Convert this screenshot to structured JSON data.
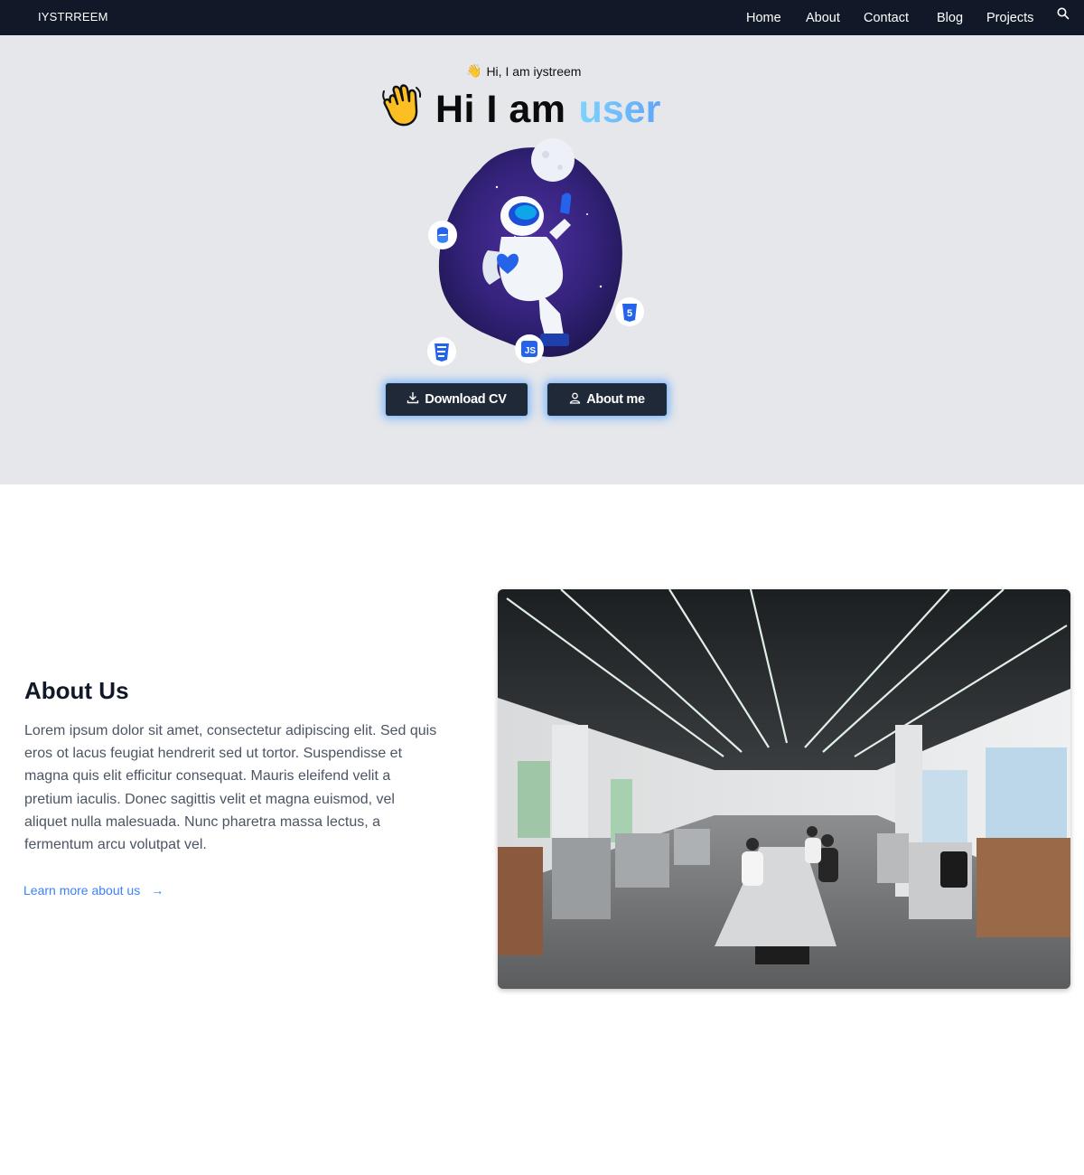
{
  "nav": {
    "brand": "IYSTRREEM",
    "links": [
      "Home",
      "About",
      "Contact",
      "Blog",
      "Projects"
    ]
  },
  "hero": {
    "greeting": "Hi, I am iystreem",
    "title": "Hi I am",
    "title_accent": "user",
    "buttons": {
      "download_cv": "Download CV",
      "about_me": "About me"
    },
    "badges": {
      "js": "JS",
      "html": "5"
    }
  },
  "about": {
    "title": "About Us",
    "text": "Lorem ipsum dolor sit amet, consectetur adipiscing elit. Sed quis eros ot lacus feugiat hendrerit sed ut tortor. Suspendisse et magna quis elit efficitur consequat. Mauris eleifend velit a pretium iaculis. Donec sagittis velit et magna euismod, vel aliquet nulla malesuada. Nunc pharetra massa lectus, a fermentum arcu volutpat vel.",
    "link": "Learn more about us",
    "link_arrow": "→"
  },
  "colors": {
    "navbar": "#111827",
    "hero_bg": "#e5e7eb",
    "button_bg": "#1f2937",
    "accent": "#60a5fa",
    "link": "#3b82f6"
  },
  "icons": [
    "search-icon",
    "waving-hand-icon",
    "download-icon",
    "user-icon",
    "python-icon",
    "css3-icon",
    "html5-icon",
    "js-icon",
    "arrow-right-icon"
  ]
}
